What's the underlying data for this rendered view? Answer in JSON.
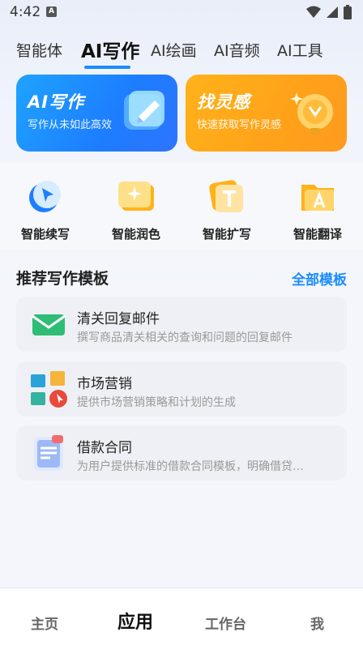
{
  "status": {
    "time": "4:42",
    "notif": "A"
  },
  "tabs": [
    {
      "label": "智能体"
    },
    {
      "label": "AI写作"
    },
    {
      "label": "AI绘画"
    },
    {
      "label": "AI音频"
    },
    {
      "label": "AI工具"
    }
  ],
  "banners": {
    "write": {
      "title": "AI写作",
      "subtitle": "写作从未如此高效"
    },
    "idea": {
      "title": "找灵感",
      "subtitle": "快速获取写作灵感"
    }
  },
  "tools": [
    {
      "label": "智能续写"
    },
    {
      "label": "智能润色"
    },
    {
      "label": "智能扩写"
    },
    {
      "label": "智能翻译"
    }
  ],
  "section": {
    "title": "推荐写作模板",
    "link": "全部模板"
  },
  "templates": [
    {
      "title": "清关回复邮件",
      "desc": "撰写商品清关相关的查询和问题的回复邮件"
    },
    {
      "title": "市场营销",
      "desc": "提供市场营销策略和计划的生成"
    },
    {
      "title": "借款合同",
      "desc": "为用户提供标准的借款合同模板，明确借贷…"
    }
  ],
  "bottom_nav": [
    {
      "label": "主页"
    },
    {
      "label": "应用"
    },
    {
      "label": "工作台"
    },
    {
      "label": "我"
    }
  ],
  "colors": {
    "accent": "#1a8cff",
    "write_banner": "#1d7dff",
    "idea_banner": "#ffa21a"
  }
}
